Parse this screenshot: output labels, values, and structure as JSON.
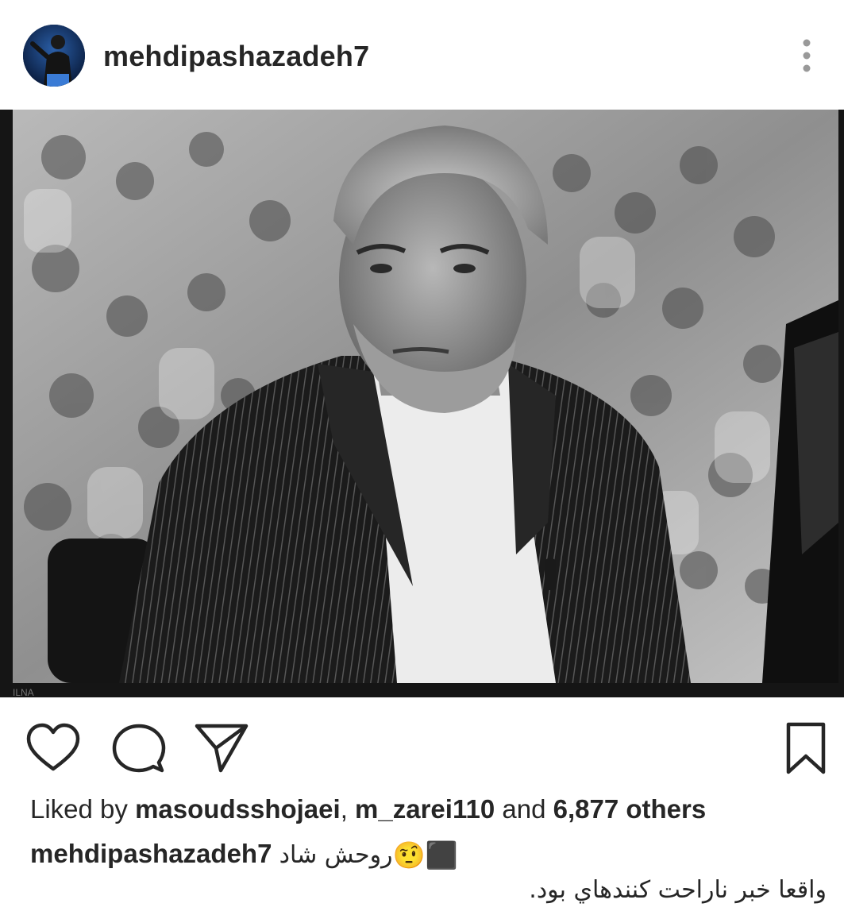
{
  "post": {
    "username": "mehdipashazadeh7",
    "more_label": "⋮"
  },
  "image": {
    "watermark": "ILNA"
  },
  "likes": {
    "prefix": "Liked by",
    "user1": "masoudsshojaei",
    "separator": ",",
    "user2": "m_zarei110",
    "and": "and",
    "count": "6,877 others"
  },
  "caption": {
    "username": "mehdipashazadeh7",
    "line1": "روحش شاد",
    "emoji1": "⬛",
    "emoji2": "🤨",
    "line2": "واقعا خبر ناراحت كنندهاي بود."
  },
  "icons": [
    "heart-icon",
    "comment-icon",
    "share-icon",
    "bookmark-icon",
    "more-icon"
  ],
  "colors": {
    "text": "#262626",
    "background": "#ffffff",
    "divider": "#efefef"
  }
}
